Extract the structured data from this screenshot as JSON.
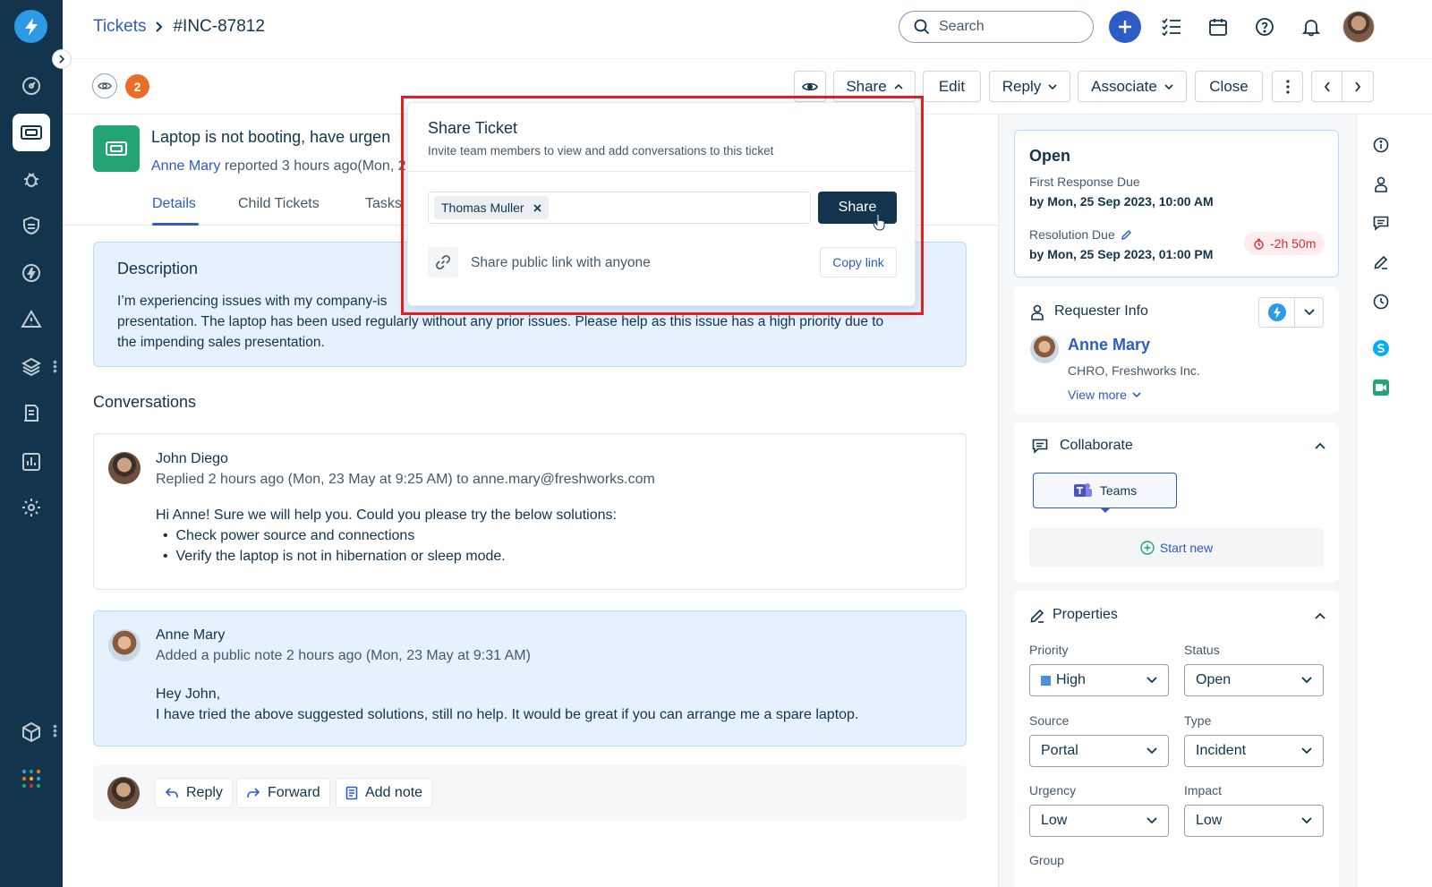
{
  "header": {
    "breadcrumb_root": "Tickets",
    "breadcrumb_separator": ">",
    "ticket_id": "#INC-87812",
    "search_placeholder": "Search"
  },
  "toolbar": {
    "watchers_count": "2",
    "buttons": {
      "share": "Share",
      "edit": "Edit",
      "reply": "Reply",
      "associate": "Associate",
      "close": "Close"
    }
  },
  "ticket": {
    "title": "Laptop is not booting, have urgen",
    "requester": "Anne Mary",
    "reported": " reported 3 hours ago(Mon, 2"
  },
  "tabs": [
    "Details",
    "Child Tickets",
    "Tasks"
  ],
  "description": {
    "title": "Description",
    "line1": "I’m experiencing issues with my company-is",
    "line2": "presentation. The laptop has been used regularly without any prior issues. Please help as this issue has a high priority due to",
    "line3": "the impending sales presentation."
  },
  "conversations": {
    "title": "Conversations",
    "items": [
      {
        "name": "John Diego",
        "meta": "Replied 2 hours ago (Mon, 23 May at 9:25 AM) to anne.mary@freshworks.com",
        "body_intro": "Hi Anne! Sure we will help you. Could you please try the below solutions:",
        "bullets": [
          "Check power source and connections",
          "Verify the laptop is not in hibernation or sleep mode."
        ]
      },
      {
        "name": "Anne Mary",
        "meta": "Added a public note 2 hours ago (Mon, 23 May at 9:31 AM)",
        "body_line1": "Hey John,",
        "body_line2": "I have tried the above suggested solutions, still no help. It would be great if you can arrange me a spare laptop."
      }
    ],
    "actions": {
      "reply": "Reply",
      "forward": "Forward",
      "add_note": "Add note"
    }
  },
  "share_popover": {
    "title": "Share Ticket",
    "subtitle": "Invite team members to view and add conversations to this ticket",
    "chip": "Thomas Muller",
    "share_button": "Share",
    "public_link_text": "Share public link with anyone",
    "copy_link": "Copy link"
  },
  "status_card": {
    "status": "Open",
    "first_response_label": "First Response Due",
    "first_response_value": "by Mon, 25 Sep 2023, 10:00 AM",
    "resolution_label": "Resolution Due",
    "resolution_value": "by Mon, 25 Sep 2023, 01:00 PM",
    "overdue": "-2h 50m"
  },
  "requester_info": {
    "title": "Requester Info",
    "name": "Anne Mary",
    "role": "CHRO, Freshworks Inc.",
    "view_more": "View more"
  },
  "collaborate": {
    "title": "Collaborate",
    "teams": "Teams",
    "start_new": "Start new"
  },
  "properties": {
    "title": "Properties",
    "priority_label": "Priority",
    "priority": "High",
    "status_label": "Status",
    "status": "Open",
    "source_label": "Source",
    "source": "Portal",
    "type_label": "Type",
    "type": "Incident",
    "urgency_label": "Urgency",
    "urgency": "Low",
    "impact_label": "Impact",
    "impact": "Low",
    "group_label": "Group"
  },
  "colors": {
    "nav_bg": "#12344d",
    "brand_blue": "#2c5cc5",
    "ticket_green": "#24a374",
    "badge_orange": "#e86f25",
    "highlight_red": "#e02020",
    "priority_high": "#4a90e2"
  }
}
